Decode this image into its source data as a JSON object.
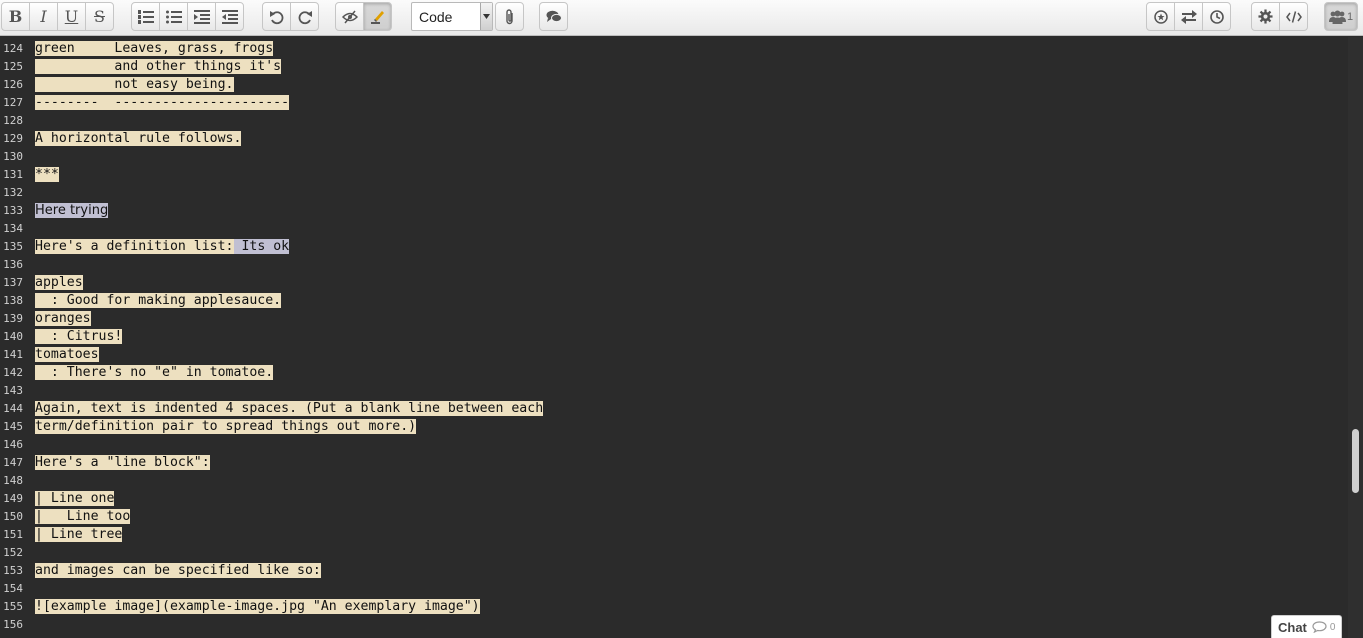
{
  "toolbar": {
    "format_select": "Code",
    "online_users": "1"
  },
  "gutter": {
    "line_numbers": [
      "124",
      "125",
      "126",
      "127",
      "128",
      "129",
      "130",
      "131",
      "132",
      "133",
      "134",
      "135",
      "136",
      "137",
      "138",
      "139",
      "140",
      "141",
      "142",
      "143",
      "144",
      "145",
      "146",
      "147",
      "148",
      "149",
      "150",
      "151",
      "152",
      "153",
      "154",
      "155",
      "156"
    ]
  },
  "editor": {
    "lines": [
      "green     Leaves, grass, frogs",
      "          and other things it's",
      "          not easy being.",
      "--------  ----------------------",
      "",
      "A horizontal rule follows.",
      "",
      "***",
      "",
      "Here trying",
      "",
      "Here's a definition list:",
      "",
      "apples",
      "  : Good for making applesauce.",
      "oranges",
      "  : Citrus!",
      "tomatoes",
      "  : There's no \"e\" in tomatoe.",
      "",
      "Again, text is indented 4 spaces. (Put a blank line between each",
      "term/definition pair to spread things out more.)",
      "",
      "Here's a \"line block\":",
      "",
      "| Line one",
      "|   Line too",
      "| Line tree",
      "",
      "and images can be specified like so:",
      "",
      "![example image](example-image.jpg \"An exemplary image\")",
      ""
    ],
    "inline_comment": " Its ok"
  },
  "chat": {
    "label": "Chat",
    "count": "0"
  },
  "colors": {
    "editor_bg": "#2b2b2b",
    "text_highlight": "#ede0c0",
    "selection_highlight": "#c0bfd2"
  }
}
